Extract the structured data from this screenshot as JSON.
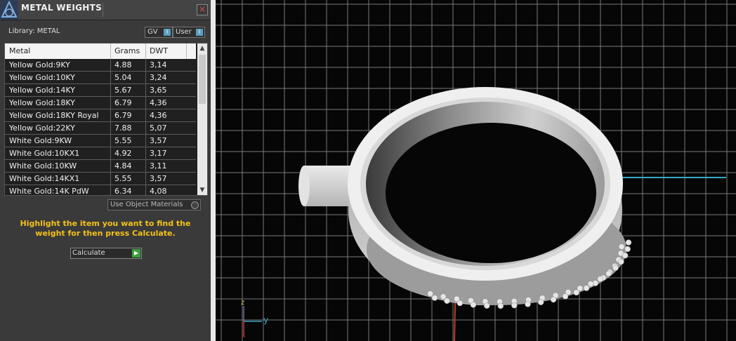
{
  "panel": {
    "title": "METAL WEIGHTS",
    "close_glyph": "×",
    "library_label": "Library: METAL",
    "toggles": [
      {
        "label": "GV",
        "knob": "I"
      },
      {
        "label": "User",
        "knob": "I"
      }
    ],
    "table": {
      "headers": [
        "Metal",
        "Grams",
        "DWT"
      ],
      "rows": [
        [
          "Yellow Gold:9KY",
          "4.88",
          "3,14"
        ],
        [
          "Yellow Gold:10KY",
          "5.04",
          "3,24"
        ],
        [
          "Yellow Gold:14KY",
          "5.67",
          "3,65"
        ],
        [
          "Yellow Gold:18KY",
          "6.79",
          "4,36"
        ],
        [
          "Yellow Gold:18KY Royal",
          "6.79",
          "4,36"
        ],
        [
          "Yellow Gold:22KY",
          "7.88",
          "5,07"
        ],
        [
          "White Gold:9KW",
          "5.55",
          "3,57"
        ],
        [
          "White Gold:10KX1",
          "4.92",
          "3,17"
        ],
        [
          "White Gold:10KW",
          "4.84",
          "3,11"
        ],
        [
          "White Gold:14KX1",
          "5.55",
          "3,57"
        ],
        [
          "White Gold:14K PdW",
          "6.34",
          "4,08"
        ]
      ]
    },
    "use_object_materials": "Use Object Materials",
    "hint": "Highlight the item you want to find the weight for then press Calculate.",
    "calculate_label": "Calculate",
    "calculate_icon": "play-icon"
  },
  "viewport": {
    "axis_labels": {
      "z": "z",
      "y": "y",
      "x": "x"
    },
    "colors": {
      "grid": "#7a7a7a",
      "axis_y": "#36a6c0",
      "axis_x": "#c0392b",
      "background": "#060606"
    }
  }
}
